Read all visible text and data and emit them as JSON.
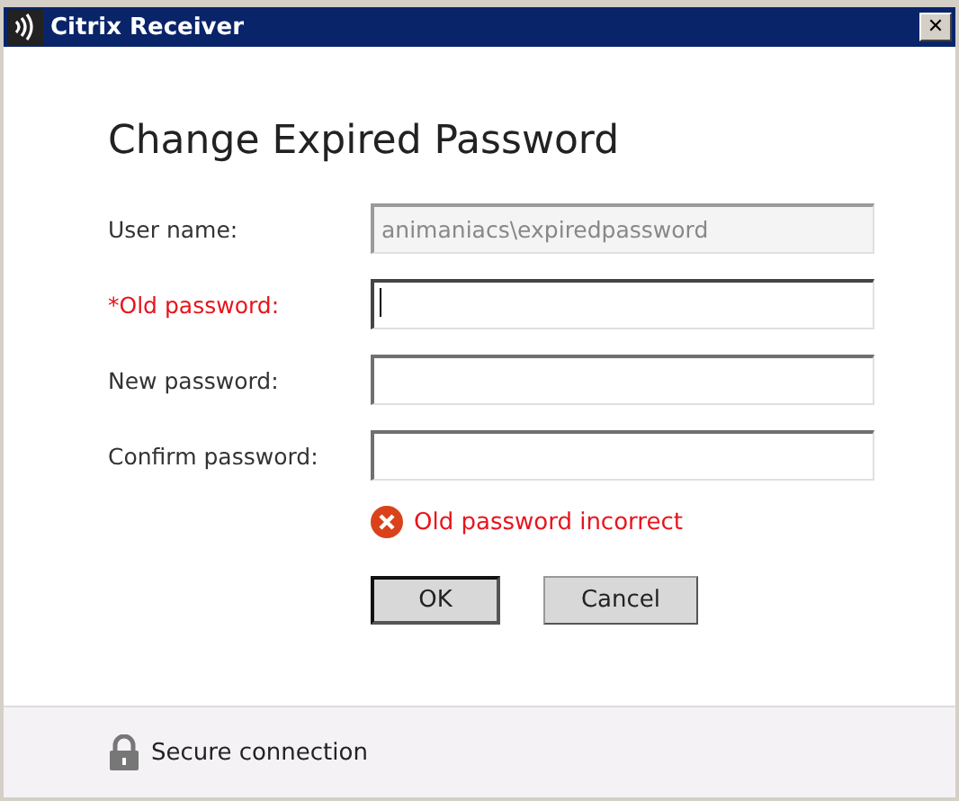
{
  "window": {
    "title": "Citrix Receiver",
    "close": "✕"
  },
  "heading": "Change Expired Password",
  "fields": [
    {
      "label": "User name:",
      "value": "animaniacs\\expiredpassword",
      "disabled": true,
      "error": false,
      "focused": false
    },
    {
      "label": "*Old password:",
      "disabled": false,
      "error": true,
      "focused": true
    },
    {
      "label": "New password:",
      "disabled": false,
      "error": false,
      "focused": false
    },
    {
      "label": "Confirm password:",
      "disabled": false,
      "error": false,
      "focused": false
    }
  ],
  "error_message": "Old password incorrect",
  "buttons": [
    {
      "label": "OK",
      "default": true
    },
    {
      "label": "Cancel",
      "default": false
    }
  ],
  "footer": {
    "text": "Secure connection"
  }
}
